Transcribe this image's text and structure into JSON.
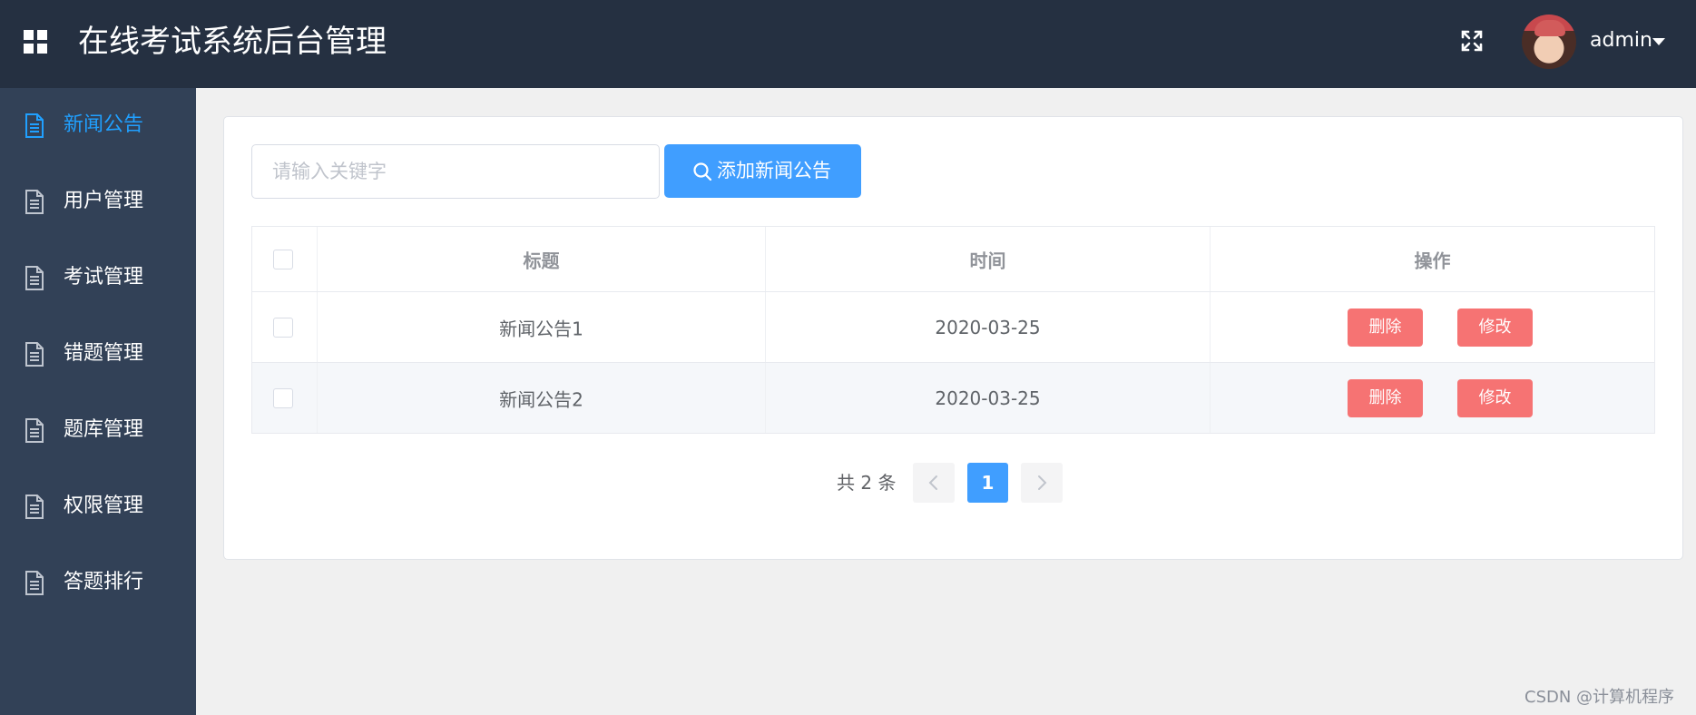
{
  "header": {
    "title": "在线考试系统后台管理",
    "user_name": "admin"
  },
  "sidebar": {
    "items": [
      {
        "label": "新闻公告",
        "active": true
      },
      {
        "label": "用户管理"
      },
      {
        "label": "考试管理"
      },
      {
        "label": "错题管理"
      },
      {
        "label": "题库管理"
      },
      {
        "label": "权限管理"
      },
      {
        "label": "答题排行"
      }
    ]
  },
  "toolbar": {
    "search_placeholder": "请输入关键字",
    "add_label": "添加新闻公告"
  },
  "table": {
    "columns": [
      "标题",
      "时间",
      "操作"
    ],
    "rows": [
      {
        "title": "新闻公告1",
        "time": "2020-03-25",
        "delete_label": "删除",
        "edit_label": "修改"
      },
      {
        "title": "新闻公告2",
        "time": "2020-03-25",
        "delete_label": "删除",
        "edit_label": "修改"
      }
    ]
  },
  "pagination": {
    "total_text": "共 2 条",
    "current_page": "1"
  },
  "watermark": "CSDN @计算机程序",
  "colors": {
    "header_bg": "#253041",
    "sidebar_bg": "#324157",
    "accent": "#409eff",
    "active_menu": "#20a0ff",
    "danger": "#f67373"
  }
}
